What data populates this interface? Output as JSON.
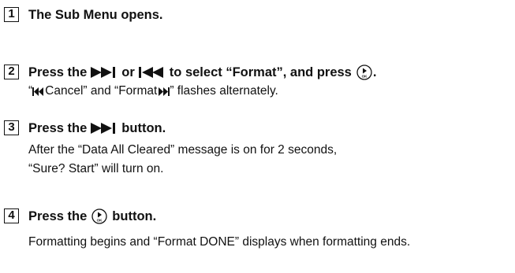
{
  "steps": [
    {
      "number": "1",
      "heading": "The Sub Menu opens."
    },
    {
      "number": "2",
      "heading_prefix": "Press the",
      "heading_or": "or",
      "heading_middle": "to select “Format”, and press",
      "heading_end": ".",
      "note_open_quote": "“",
      "note_cancel": "Cancel” and “Format",
      "note_end": "” flashes alternately.",
      "icons": [
        "next-icon",
        "prev-icon",
        "ok-button-icon",
        "skip-back-icon",
        "skip-forward-icon"
      ]
    },
    {
      "number": "3",
      "heading_prefix": "Press the",
      "heading_suffix": "button.",
      "body_line1": "After the “Data All Cleared” message is on for 2 seconds,",
      "body_line2": "“Sure? Start” will turn on.",
      "icons": [
        "next-icon"
      ]
    },
    {
      "number": "4",
      "heading_prefix": "Press the",
      "heading_suffix": "button.",
      "body_line1": "Formatting begins and “Format DONE” displays when formatting ends.",
      "icons": [
        "ok-button-icon"
      ]
    }
  ],
  "colors": {
    "text": "#111111",
    "background": "#ffffff"
  }
}
